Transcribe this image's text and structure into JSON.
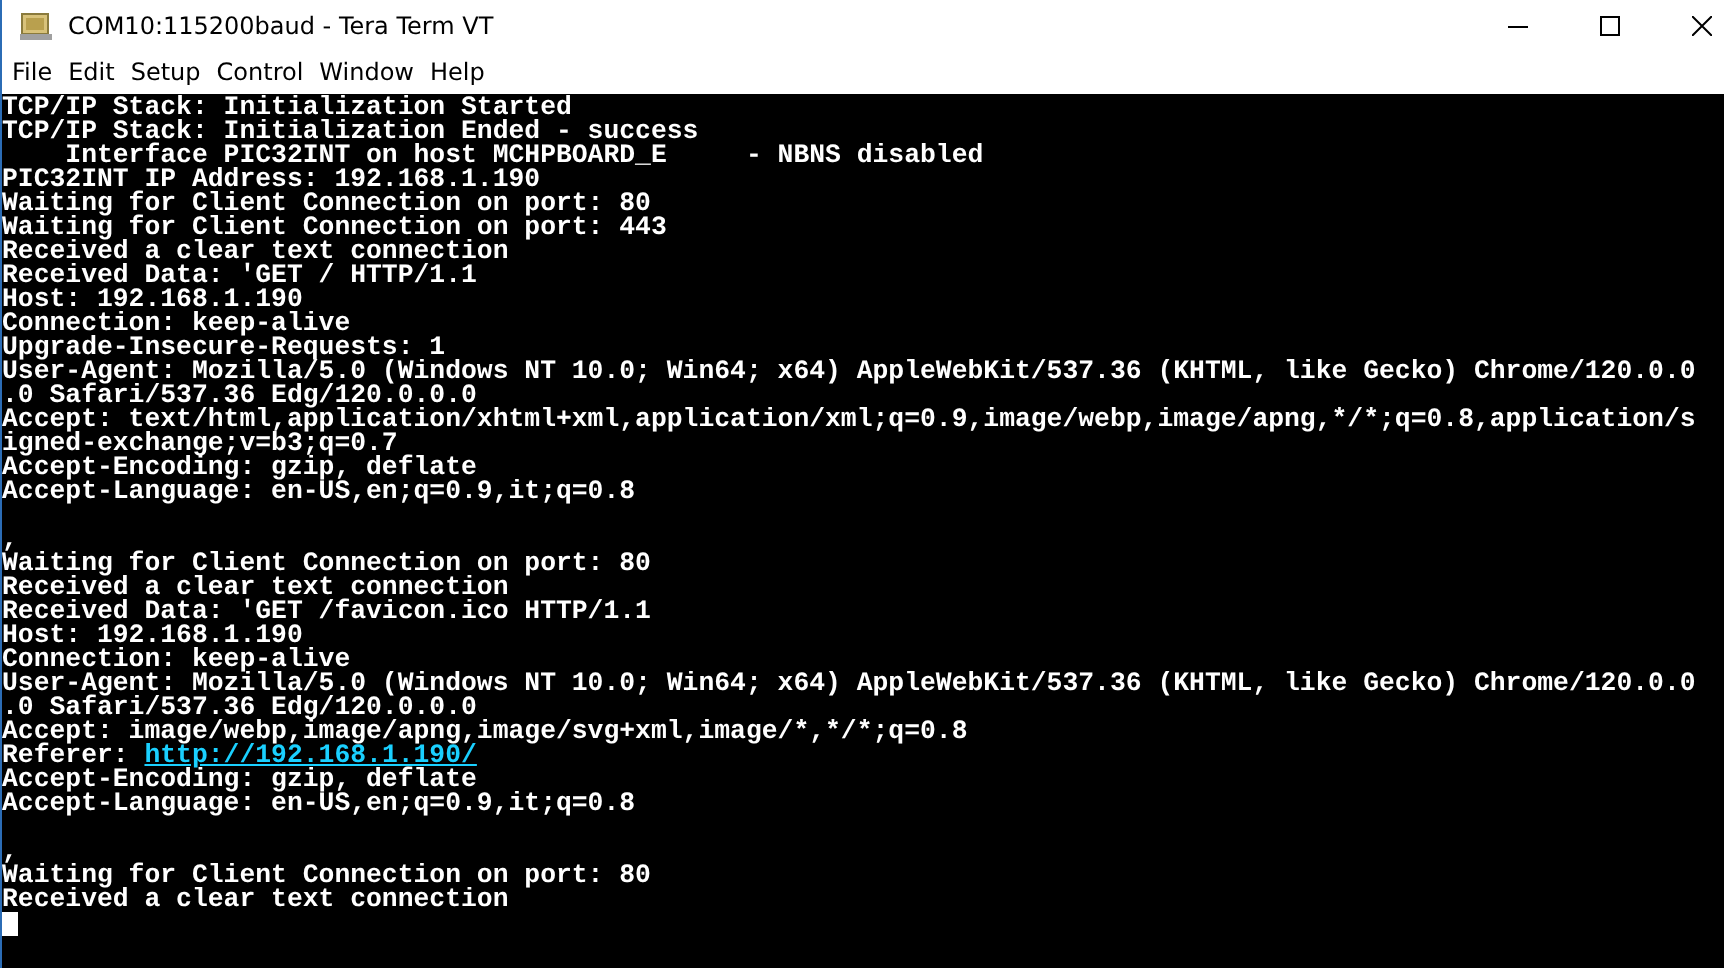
{
  "window": {
    "title": "COM10:115200baud - Tera Term VT"
  },
  "menu": [
    "File",
    "Edit",
    "Setup",
    "Control",
    "Window",
    "Help"
  ],
  "terminal": {
    "lines": [
      {
        "kind": "text",
        "text": "TCP/IP Stack: Initialization Started"
      },
      {
        "kind": "text",
        "text": "TCP/IP Stack: Initialization Ended - success"
      },
      {
        "kind": "text",
        "text": "    Interface PIC32INT on host MCHPBOARD_E     - NBNS disabled"
      },
      {
        "kind": "text",
        "text": "PIC32INT IP Address: 192.168.1.190"
      },
      {
        "kind": "text",
        "text": "Waiting for Client Connection on port: 80"
      },
      {
        "kind": "text",
        "text": "Waiting for Client Connection on port: 443"
      },
      {
        "kind": "text",
        "text": "Received a clear text connection"
      },
      {
        "kind": "text",
        "text": "Received Data: 'GET / HTTP/1.1"
      },
      {
        "kind": "text",
        "text": "Host: 192.168.1.190"
      },
      {
        "kind": "text",
        "text": "Connection: keep-alive"
      },
      {
        "kind": "text",
        "text": "Upgrade-Insecure-Requests: 1"
      },
      {
        "kind": "text",
        "text": "User-Agent: Mozilla/5.0 (Windows NT 10.0; Win64; x64) AppleWebKit/537.36 (KHTML, like Gecko) Chrome/120.0.0"
      },
      {
        "kind": "text",
        "text": ".0 Safari/537.36 Edg/120.0.0.0"
      },
      {
        "kind": "text",
        "text": "Accept: text/html,application/xhtml+xml,application/xml;q=0.9,image/webp,image/apng,*/*;q=0.8,application/s"
      },
      {
        "kind": "text",
        "text": "igned-exchange;v=b3;q=0.7"
      },
      {
        "kind": "text",
        "text": "Accept-Encoding: gzip, deflate"
      },
      {
        "kind": "text",
        "text": "Accept-Language: en-US,en;q=0.9,it;q=0.8"
      },
      {
        "kind": "blank"
      },
      {
        "kind": "text",
        "text": ","
      },
      {
        "kind": "text",
        "text": "Waiting for Client Connection on port: 80"
      },
      {
        "kind": "text",
        "text": "Received a clear text connection"
      },
      {
        "kind": "text",
        "text": "Received Data: 'GET /favicon.ico HTTP/1.1"
      },
      {
        "kind": "text",
        "text": "Host: 192.168.1.190"
      },
      {
        "kind": "text",
        "text": "Connection: keep-alive"
      },
      {
        "kind": "text",
        "text": "User-Agent: Mozilla/5.0 (Windows NT 10.0; Win64; x64) AppleWebKit/537.36 (KHTML, like Gecko) Chrome/120.0.0"
      },
      {
        "kind": "text",
        "text": ".0 Safari/537.36 Edg/120.0.0.0"
      },
      {
        "kind": "text",
        "text": "Accept: image/webp,image/apng,image/svg+xml,image/*,*/*;q=0.8"
      },
      {
        "kind": "link",
        "text": "Referer: ",
        "link": "http://192.168.1.190/"
      },
      {
        "kind": "text",
        "text": "Accept-Encoding: gzip, deflate"
      },
      {
        "kind": "text",
        "text": "Accept-Language: en-US,en;q=0.9,it;q=0.8"
      },
      {
        "kind": "blank"
      },
      {
        "kind": "text",
        "text": ","
      },
      {
        "kind": "text",
        "text": "Waiting for Client Connection on port: 80"
      },
      {
        "kind": "text",
        "text": "Received a clear text connection"
      },
      {
        "kind": "cursor"
      }
    ]
  }
}
